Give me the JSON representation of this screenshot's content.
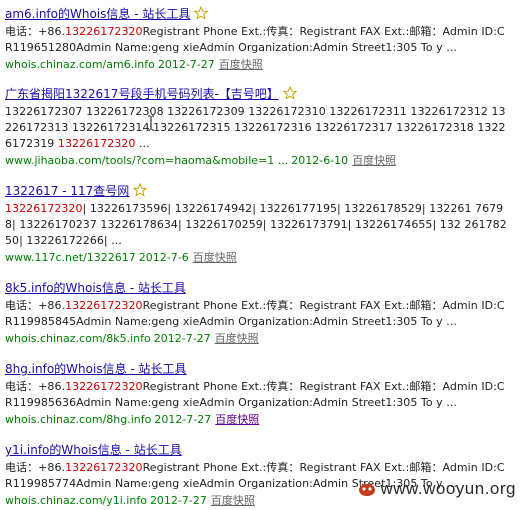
{
  "results": [
    {
      "title": "am6.info的Whois信息 - 站长工具",
      "snippet_segments": [
        {
          "text": "电话：+86.",
          "hl": false
        },
        {
          "text": "13226172320",
          "hl": true
        },
        {
          "text": "Registrant Phone Ext.:传真：Registrant FAX Ext.:邮箱：Admin ID:CR119651280Admin Name:geng xieAdmin Organization:Admin Street1:305 To y ...",
          "hl": false
        }
      ],
      "url": "whois.chinaz.com/am6.info",
      "date": "2012-7-27",
      "cache": "百度快照"
    },
    {
      "title": "广东省揭阳1322617号段手机号码列表-【吉号吧】",
      "snippet_segments": [
        {
          "text": "13226172307 13226172308 13226172309 13226172310 13226172311 13226172312 13226172313 13226172314 13226172315 13226172316 13226172317 13226172318 13226172319 ",
          "hl": false
        },
        {
          "text": "13226172320",
          "hl": true
        },
        {
          "text": " ...",
          "hl": false
        }
      ],
      "url": "www.jihaoba.com/tools/?com=haoma&mobile=1 ...",
      "date": "2012-6-10",
      "cache": "百度快照"
    },
    {
      "title": "1322617 - 117查号网",
      "snippet_segments": [
        {
          "text": "13226172320",
          "hl": true
        },
        {
          "text": "| 13226173596| 13226174942| 13226177195| 13226178529| 132261 76798| 13226170237 13226178634| 13226170259| 13226173791| 13226174655| 132 26178250| 13226172266| ...",
          "hl": false
        }
      ],
      "url": "www.117c.net/1322617",
      "date": "2012-7-6",
      "cache": "百度快照"
    },
    {
      "title": "8k5.info的Whois信息 - 站长工具",
      "snippet_segments": [
        {
          "text": "电话：+86.",
          "hl": false
        },
        {
          "text": "13226172320",
          "hl": true
        },
        {
          "text": "Registrant Phone Ext.:传真：Registrant FAX Ext.:邮箱：Admin ID:CR119985845Admin Name:geng xieAdmin Organization:Admin Street1:305 To y ...",
          "hl": false
        }
      ],
      "url": "whois.chinaz.com/8k5.info",
      "date": "2012-7-27",
      "cache": "百度快照"
    },
    {
      "title": "8hg.info的Whois信息 - 站长工具",
      "snippet_segments": [
        {
          "text": "电话：+86.",
          "hl": false
        },
        {
          "text": "13226172320",
          "hl": true
        },
        {
          "text": "Registrant Phone Ext.:传真：Registrant FAX Ext.:邮箱：Admin ID:CR119985636Admin Name:geng xieAdmin Organization:Admin Street1:305 To y ...",
          "hl": false
        }
      ],
      "url": "whois.chinaz.com/8hg.info",
      "date": "2012-7-27",
      "cache": "百度快照"
    },
    {
      "title": "y1i.info的Whois信息 - 站长工具",
      "snippet_segments": [
        {
          "text": "电话：+86.",
          "hl": false
        },
        {
          "text": "13226172320",
          "hl": true
        },
        {
          "text": "Registrant Phone Ext.:传真：Registrant FAX Ext.:邮箱：Admin ID:CR119985774Admin Name:geng xieAdmin Organization:Admin Street1:305 To y ...",
          "hl": false
        }
      ],
      "url": "whois.chinaz.com/y1i.info",
      "date": "2012-7-27",
      "cache": "百度快照"
    }
  ],
  "watermark": {
    "text": "www.wooyun.org"
  },
  "colors": {
    "title_link": "#1a0dab",
    "highlight": "#cc0000",
    "url": "#008000",
    "cache": "#666666"
  },
  "icons": {
    "star": "star-icon",
    "cursor": "text-cursor-icon",
    "watermark_logo": "wooyun-logo-icon"
  }
}
